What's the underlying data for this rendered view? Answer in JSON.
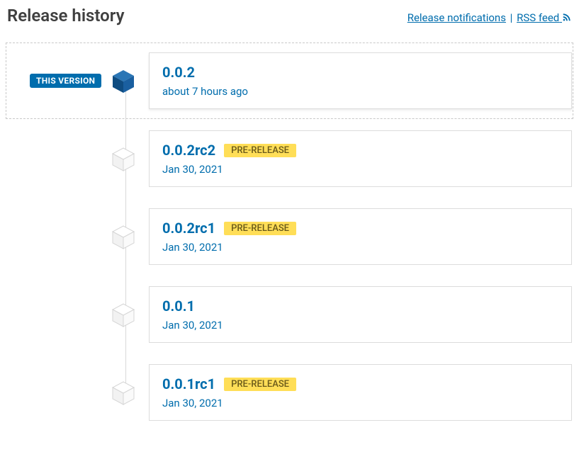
{
  "header": {
    "title": "Release history",
    "notifications_label": "Release notifications",
    "rss_label": "RSS feed"
  },
  "badge_current": "THIS VERSION",
  "badge_prerelease": "PRE-RELEASE",
  "releases": [
    {
      "version": "0.0.2",
      "date": "about 7 hours ago",
      "current": true,
      "prerelease": false
    },
    {
      "version": "0.0.2rc2",
      "date": "Jan 30, 2021",
      "current": false,
      "prerelease": true
    },
    {
      "version": "0.0.2rc1",
      "date": "Jan 30, 2021",
      "current": false,
      "prerelease": true
    },
    {
      "version": "0.0.1",
      "date": "Jan 30, 2021",
      "current": false,
      "prerelease": false
    },
    {
      "version": "0.0.1rc1",
      "date": "Jan 30, 2021",
      "current": false,
      "prerelease": true
    }
  ]
}
